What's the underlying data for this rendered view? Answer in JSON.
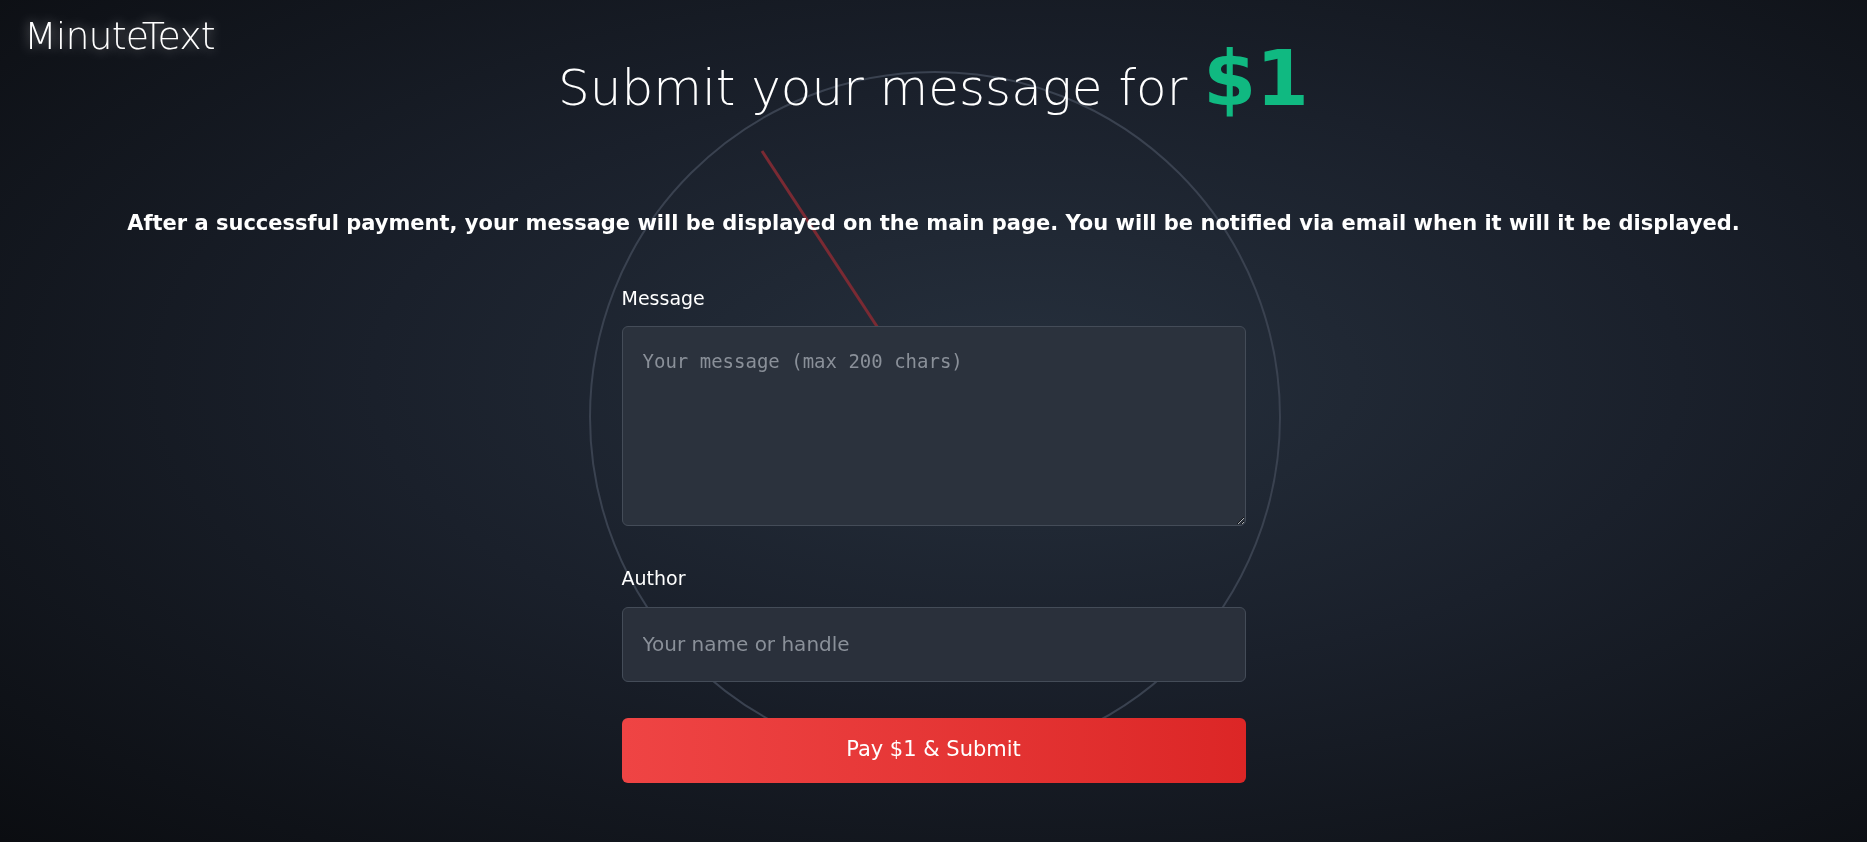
{
  "logo": "MinuteText",
  "heading": {
    "text": "Submit your message for",
    "price": "$1"
  },
  "notice": "After a successful payment, your message will be displayed on the main page. You will be notified via email when it will it be displayed.",
  "fields": [
    {
      "kind": "textarea",
      "label": "Message",
      "placeholder": "Your message (max 200 chars)"
    },
    {
      "kind": "input",
      "label": "Author",
      "placeholder": "Your name or handle"
    }
  ],
  "submit_button": "Pay $1 & Submit"
}
